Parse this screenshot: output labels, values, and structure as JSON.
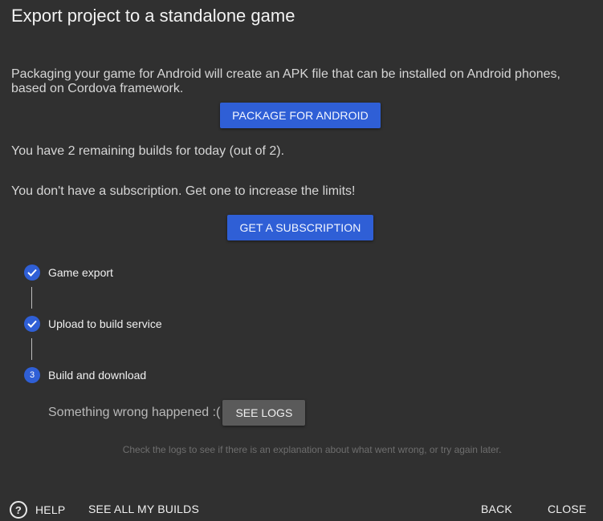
{
  "dialog": {
    "title": "Export project to a standalone game",
    "description": "Packaging your game for Android will create an APK file that can be installed on Android phones, based on Cordova framework.",
    "package_button": "PACKAGE FOR ANDROID",
    "remaining_builds": "You have 2 remaining builds for today (out of 2).",
    "no_subscription": "You don't have a subscription. Get one to increase the limits!",
    "subscription_button": "GET A SUBSCRIPTION"
  },
  "steps": [
    {
      "label": "Game export",
      "state": "done",
      "icon": "check-icon"
    },
    {
      "label": "Upload to build service",
      "state": "done",
      "icon": "check-icon"
    },
    {
      "label": "Build and download",
      "state": "active",
      "number": "3"
    }
  ],
  "build_error": {
    "message": "Something wrong happened :(",
    "logs_button": "SEE LOGS",
    "hint": "Check the logs to see if there is an explanation about what went wrong, or try again later."
  },
  "footer": {
    "help_label": "HELP",
    "help_icon": "question-circle-icon",
    "see_all_builds": "SEE ALL MY BUILDS",
    "back": "BACK",
    "close": "CLOSE"
  },
  "colors": {
    "background": "#303030",
    "accent": "#2f5fd6",
    "secondary_button": "#5a5a5a"
  }
}
